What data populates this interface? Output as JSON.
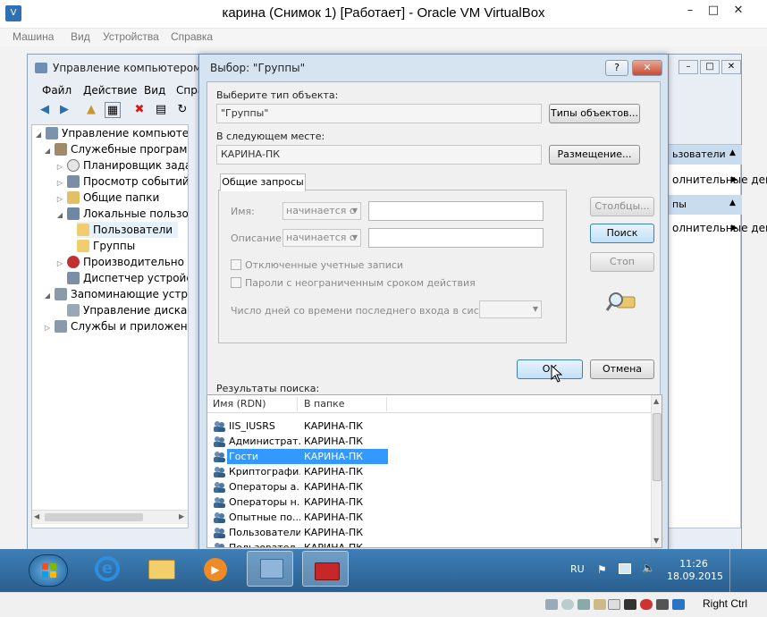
{
  "host": {
    "title": "карина (Снимок 1) [Работает] - Oracle VM VirtualBox",
    "menu": [
      "Машина",
      "Вид",
      "Устройства",
      "Справка"
    ],
    "status_key": "Right Ctrl"
  },
  "cm": {
    "title": "Управление компьютером",
    "menu": [
      "Файл",
      "Действие",
      "Вид",
      "Спра"
    ],
    "tree": [
      {
        "label": "Управление компьютером",
        "icon": "computer-icon"
      },
      {
        "label": "Служебные программ",
        "icon": "tools-icon"
      },
      {
        "label": "Планировщик зада",
        "icon": "clock-icon"
      },
      {
        "label": "Просмотр событий",
        "icon": "event-icon"
      },
      {
        "label": "Общие папки",
        "icon": "share-icon"
      },
      {
        "label": "Локальные пользо",
        "icon": "users-icon"
      },
      {
        "label": "Пользователи",
        "icon": "folder-icon"
      },
      {
        "label": "Группы",
        "icon": "folder-icon"
      },
      {
        "label": "Производительно",
        "icon": "perf-icon"
      },
      {
        "label": "Диспетчер устройс",
        "icon": "device-icon"
      },
      {
        "label": "Запоминающие устро",
        "icon": "storage-icon"
      },
      {
        "label": "Управление дискам",
        "icon": "disk-icon"
      },
      {
        "label": "Службы и приложени",
        "icon": "services-icon"
      }
    ],
    "actions": [
      {
        "label": "ьзователи"
      },
      {
        "label": "олнительные дей..."
      },
      {
        "label": "пы"
      },
      {
        "label": "олнительные дей..."
      }
    ]
  },
  "dialog": {
    "title": "Выбор: \"Группы\"",
    "object_type_label": "Выберите тип объекта:",
    "object_type_value": "\"Группы\"",
    "object_types_button": "Типы объектов...",
    "location_label": "В следующем месте:",
    "location_value": "КАРИНА-ПК",
    "location_button": "Размещение...",
    "tab": "Общие запросы",
    "name_label": "Имя:",
    "name_op": "начинается с",
    "desc_label": "Описание:",
    "desc_op": "начинается с",
    "chk_disabled": "Отключенные учетные записи",
    "chk_nonexpiring": "Пароли с неограниченным сроком действия",
    "days_label": "Число дней со времени последнего входа в систему:",
    "columns_button": "Столбцы...",
    "search_button": "Поиск",
    "stop_button": "Стоп",
    "ok_button": "ОК",
    "cancel_button": "Отмена",
    "results_label": "Результаты поиска:",
    "col_name": "Имя (RDN)",
    "col_folder": "В папке",
    "rows": [
      {
        "name": "IIS_IUSRS",
        "folder": "КАРИНА-ПК"
      },
      {
        "name": "Администрат...",
        "folder": "КАРИНА-ПК"
      },
      {
        "name": "Гости",
        "folder": "КАРИНА-ПК",
        "selected": true
      },
      {
        "name": "Криптографи...",
        "folder": "КАРИНА-ПК"
      },
      {
        "name": "Операторы а...",
        "folder": "КАРИНА-ПК"
      },
      {
        "name": "Операторы н...",
        "folder": "КАРИНА-ПК"
      },
      {
        "name": "Опытные по...",
        "folder": "КАРИНА-ПК"
      },
      {
        "name": "Пользователи",
        "folder": "КАРИНА-ПК"
      },
      {
        "name": "Пользовател...",
        "folder": "КАРИНА-ПК"
      }
    ]
  },
  "taskbar": {
    "lang": "RU",
    "time": "11:26",
    "date": "18.09.2015"
  }
}
